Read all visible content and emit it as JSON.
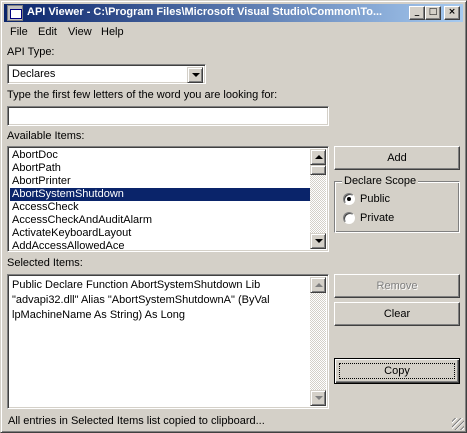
{
  "window": {
    "title": "API Viewer - C:\\Program Files\\Microsoft Visual Studio\\Common\\To...",
    "controls": {
      "minimize": "_",
      "maximize": "□",
      "close": "×"
    }
  },
  "menu": [
    {
      "label": "File"
    },
    {
      "label": "Edit"
    },
    {
      "label": "View"
    },
    {
      "label": "Help"
    }
  ],
  "api_type": {
    "label": "API Type:",
    "selected": "Declares"
  },
  "search": {
    "label": "Type the first few letters of the word you are looking for:",
    "value": ""
  },
  "available_items": {
    "label": "Available Items:",
    "items": [
      "AbortDoc",
      "AbortPath",
      "AbortPrinter",
      "AbortSystemShutdown",
      "AccessCheck",
      "AccessCheckAndAuditAlarm",
      "ActivateKeyboardLayout",
      "AddAccessAllowedAce"
    ],
    "selected_index": 3
  },
  "buttons": {
    "add": "Add",
    "remove": "Remove",
    "clear": "Clear",
    "copy": "Copy"
  },
  "declare_scope": {
    "title": "Declare Scope",
    "options": [
      {
        "label": "Public",
        "checked": true
      },
      {
        "label": "Private",
        "checked": false
      }
    ]
  },
  "selected_items": {
    "label": "Selected Items:",
    "text": "Public Declare Function AbortSystemShutdown Lib \"advapi32.dll\" Alias \"AbortSystemShutdownA\" (ByVal lpMachineName As String) As Long"
  },
  "status": {
    "text": "All entries in Selected Items list copied to clipboard..."
  },
  "colors": {
    "face": "#d4d0c8",
    "title_start": "#0a246a",
    "title_end": "#a6caf0",
    "selection": "#0a246a"
  }
}
